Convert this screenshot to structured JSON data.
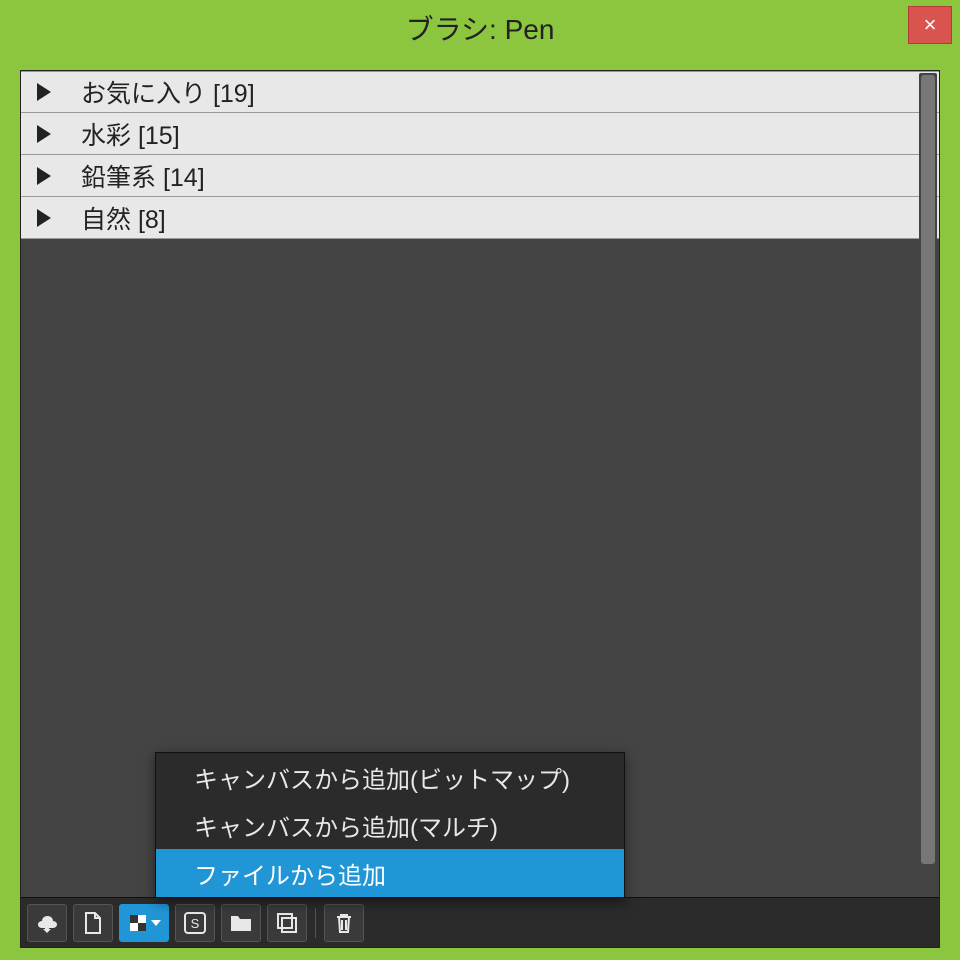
{
  "window": {
    "title": "ブラシ: Pen",
    "close_label": "×"
  },
  "categories": [
    {
      "label": "お気に入り [19]"
    },
    {
      "label": "水彩 [15]"
    },
    {
      "label": "鉛筆系 [14]"
    },
    {
      "label": "自然 [8]"
    }
  ],
  "popup": {
    "items": [
      {
        "label": "キャンバスから追加(ビットマップ)",
        "highlight": false
      },
      {
        "label": "キャンバスから追加(マルチ)",
        "highlight": false
      },
      {
        "label": "ファイルから追加",
        "highlight": true
      }
    ]
  },
  "toolbar": {
    "cloud": "cloud-download",
    "new": "new-document",
    "add": "add-brush",
    "s": "s-option",
    "folder": "folder",
    "copy": "duplicate",
    "delete": "delete"
  }
}
